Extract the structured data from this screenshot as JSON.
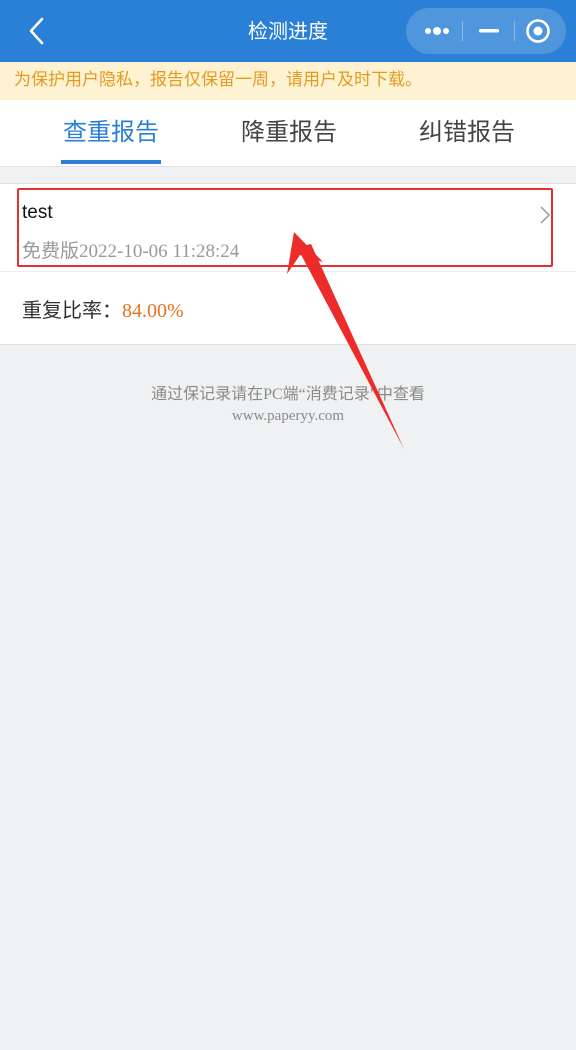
{
  "nav": {
    "title": "检测进度",
    "icons": [
      "back-icon",
      "more-icon",
      "minimize-icon",
      "close-circle-icon"
    ]
  },
  "notice": {
    "text": "为保护用户隐私，报告仅保留一周，请用户及时下载。"
  },
  "tabs": [
    {
      "label": "查重报告",
      "active": true
    },
    {
      "label": "降重报告",
      "active": false
    },
    {
      "label": "纠错报告",
      "active": false
    }
  ],
  "report": {
    "title": "test",
    "subtitle": "免费版2022-10-06 11:28:24",
    "rate_label": "重复比率：",
    "rate_value": "84.00%"
  },
  "footer": {
    "note": "通过保记录请在PC端“消费记录”中查看",
    "url": "www.paperyy.com"
  },
  "colors": {
    "nav_bg": "#2a7fd6",
    "notice_text": "#e59a1f",
    "rate_value": "#e8711e",
    "highlight": "#e43030"
  }
}
